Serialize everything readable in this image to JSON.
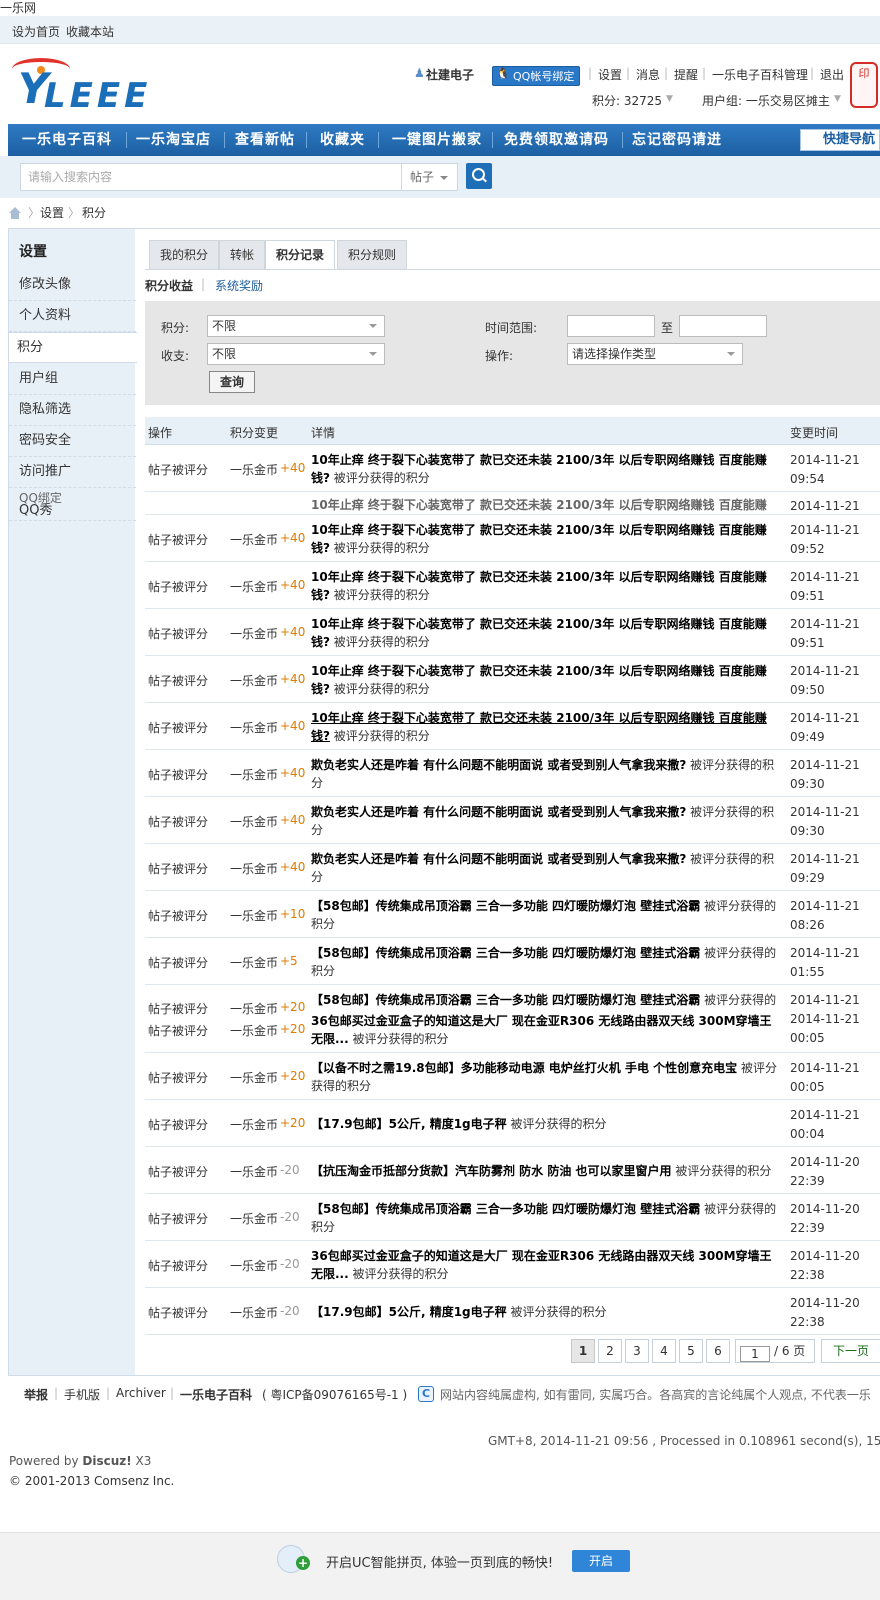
{
  "page_title": "一乐网",
  "topbar": {
    "set_home": "设为首页",
    "bookmark": "收藏本站"
  },
  "logo": {
    "text": "LEEE",
    "letter": "Y"
  },
  "user": {
    "name": "社建电子",
    "qq_bind": "QQ帐号绑定",
    "links": [
      "设置",
      "消息",
      "提醒",
      "一乐电子百科管理",
      "退出"
    ],
    "points_label": "积分: 32725",
    "group_label": "用户组: 一乐交易区摊主",
    "stamp": "印"
  },
  "nav": {
    "items": [
      "一乐电子百科",
      "一乐淘宝店",
      "查看新帖",
      "收藏夹",
      "一键图片搬家",
      "免费领取邀请码",
      "忘记密码请进"
    ],
    "quick_nav": "快捷导航"
  },
  "search": {
    "placeholder": "请输入搜索内容",
    "type": "帖子"
  },
  "breadcrumb": [
    "设置",
    "积分"
  ],
  "sidebar": {
    "title": "设置",
    "items": [
      "修改头像",
      "个人资料",
      "积分",
      "用户组",
      "隐私筛选",
      "密码安全",
      "访问推广",
      "QQ绑定",
      "QQ秀"
    ]
  },
  "tabs": [
    "我的积分",
    "转帐",
    "积分记录",
    "积分规则"
  ],
  "subtabs": [
    "积分收益",
    "系统奖励"
  ],
  "filter": {
    "points_label": "积分:",
    "points_value": "不限",
    "inout_label": "收支:",
    "inout_value": "不限",
    "time_label": "时间范围:",
    "to": "至",
    "op_label": "操作:",
    "op_value": "请选择操作类型",
    "submit": "查询"
  },
  "table": {
    "headers": [
      "操作",
      "积分变更",
      "详情",
      "变更时间"
    ],
    "suffix": "被评分获得的积分",
    "rows": [
      {
        "op": "帖子被评分",
        "chg": "一乐金币",
        "amt": "+40",
        "title": "10年止痒 终于裂下心装宽带了 款已交还未装 2100/3年 以后专职网络赚钱 百度能赚钱?",
        "date": "2014-11-21",
        "time": "09:54"
      },
      {
        "op": "帖子被评分",
        "chg": "一乐金币",
        "amt": "+40",
        "title": "10年止痒 终于裂下心装宽带了 款已交还未装 2100/3年 以后专职网络赚钱 百度能赚钱?",
        "date": "2014-11-21",
        "time": "09:52"
      },
      {
        "op": "帖子被评分",
        "chg": "一乐金币",
        "amt": "+40",
        "title": "10年止痒 终于裂下心装宽带了 款已交还未装 2100/3年 以后专职网络赚钱 百度能赚钱?",
        "date": "2014-11-21",
        "time": "09:51"
      },
      {
        "op": "帖子被评分",
        "chg": "一乐金币",
        "amt": "+40",
        "title": "10年止痒 终于裂下心装宽带了 款已交还未装 2100/3年 以后专职网络赚钱 百度能赚钱?",
        "date": "2014-11-21",
        "time": "09:51"
      },
      {
        "op": "帖子被评分",
        "chg": "一乐金币",
        "amt": "+40",
        "title": "10年止痒 终于裂下心装宽带了 款已交还未装 2100/3年 以后专职网络赚钱 百度能赚钱?",
        "date": "2014-11-21",
        "time": "09:50"
      },
      {
        "op": "帖子被评分",
        "chg": "一乐金币",
        "amt": "+40",
        "title": "10年止痒 终于裂下心装宽带了 款已交还未装 2100/3年 以后专职网络赚钱 百度能赚钱?",
        "date": "2014-11-21",
        "time": "09:49"
      },
      {
        "op": "帖子被评分",
        "chg": "一乐金币",
        "amt": "+40",
        "title": "欺负老实人还是咋着 有什么问题不能明面说 或者受到别人气拿我来撒?",
        "date": "2014-11-21",
        "time": "09:30"
      },
      {
        "op": "帖子被评分",
        "chg": "一乐金币",
        "amt": "+40",
        "title": "欺负老实人还是咋着 有什么问题不能明面说 或者受到别人气拿我来撒?",
        "date": "2014-11-21",
        "time": "09:30"
      },
      {
        "op": "帖子被评分",
        "chg": "一乐金币",
        "amt": "+40",
        "title": "欺负老实人还是咋着 有什么问题不能明面说 或者受到别人气拿我来撒?",
        "date": "2014-11-21",
        "time": "09:29"
      },
      {
        "op": "帖子被评分",
        "chg": "一乐金币",
        "amt": "+10",
        "title": "【58包邮】传统集成吊顶浴霸 三合一多功能 四灯暖防爆灯泡 壁挂式浴霸",
        "date": "2014-11-21",
        "time": "08:26"
      },
      {
        "op": "帖子被评分",
        "chg": "一乐金币",
        "amt": "+5",
        "title": "【58包邮】传统集成吊顶浴霸 三合一多功能 四灯暖防爆灯泡 壁挂式浴霸",
        "date": "2014-11-21",
        "time": "01:55"
      },
      {
        "op": "帖子被评分",
        "chg": "一乐金币",
        "amt": "+20",
        "title": "【58包邮】传统集成吊顶浴霸 三合一多功能 四灯暖防爆灯泡 壁挂式浴霸",
        "date": "2014-11-21",
        "time": ""
      },
      {
        "op": "帖子被评分",
        "chg": "一乐金币",
        "amt": "+20",
        "title": "36包邮买过金亚盒子的知道这是大厂 现在金亚R306 无线路由器双天线 300M穿墙王 无限...",
        "date": "2014-11-21",
        "time": "00:05"
      },
      {
        "op": "帖子被评分",
        "chg": "一乐金币",
        "amt": "+20",
        "title": "【以备不时之需19.8包邮】多功能移动电源 电炉丝打火机 手电 个性创意充电宝",
        "date": "2014-11-21",
        "time": "00:05"
      },
      {
        "op": "帖子被评分",
        "chg": "一乐金币",
        "amt": "+20",
        "title": "【17.9包邮】5公斤, 精度1g电子秤",
        "date": "2014-11-21",
        "time": "00:04"
      },
      {
        "op": "帖子被评分",
        "chg": "一乐金币",
        "amt": "-20",
        "title": "【抗压淘金币抵部分货款】汽车防雾剂 防水 防油 也可以家里窗户用",
        "date": "2014-11-20",
        "time": "22:39"
      },
      {
        "op": "帖子被评分",
        "chg": "一乐金币",
        "amt": "-20",
        "title": "【58包邮】传统集成吊顶浴霸 三合一多功能 四灯暖防爆灯泡 壁挂式浴霸",
        "date": "2014-11-20",
        "time": "22:39"
      },
      {
        "op": "帖子被评分",
        "chg": "一乐金币",
        "amt": "-20",
        "title": "36包邮买过金亚盒子的知道这是大厂 现在金亚R306 无线路由器双天线 300M穿墙王 无限...",
        "date": "2014-11-20",
        "time": "22:38"
      },
      {
        "op": "帖子被评分",
        "chg": "一乐金币",
        "amt": "-20",
        "title": "【17.9包邮】5公斤, 精度1g电子秤",
        "date": "2014-11-20",
        "time": "22:38"
      }
    ]
  },
  "pager": {
    "pages": [
      "1",
      "2",
      "3",
      "4",
      "5",
      "6"
    ],
    "jump_value": "1",
    "total": "/ 6 页",
    "next": "下一页"
  },
  "footer": {
    "links": [
      "举报",
      "手机版",
      "Archiver"
    ],
    "site": "一乐电子百科",
    "icp": "( 粤ICP备09076165号-1 )",
    "notice": "网站内容纯属虚构, 如有雷同, 实属巧合。各高宾的言论纯属个人观点, 不代表一乐",
    "gmt": "GMT+8, 2014-11-21 09:56 , Processed in 0.108961 second(s), 15 que",
    "powered_prefix": "Powered by ",
    "powered_name": "Discuz!",
    "powered_ver": " X3",
    "copyright": "© 2001-2013 Comsenz Inc."
  },
  "ucbar": {
    "text": "开启UC智能拼页, 体验一页到底的畅快!",
    "button": "开启"
  },
  "colors": {
    "nav": "#1f6cb4",
    "accent_positive": "#e07b00",
    "link_green": "#1b6d1b"
  }
}
